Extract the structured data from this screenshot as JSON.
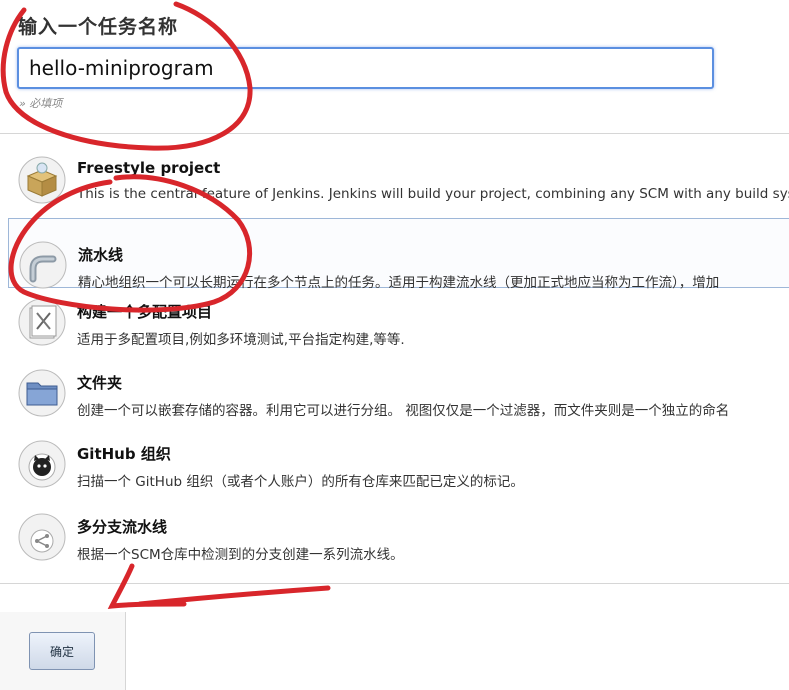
{
  "form": {
    "title": "输入一个任务名称",
    "name_value": "hello-miniprogram",
    "required_hint": "» 必填项"
  },
  "items": [
    {
      "title": "Freestyle project",
      "description": "This is the central feature of Jenkins. Jenkins will build your project, combining any SCM with any build system",
      "icon": "freestyle-box-icon"
    },
    {
      "title": "流水线",
      "description": "精心地组织一个可以长期运行在多个节点上的任务。适用于构建流水线（更加正式地应当称为工作流），增加",
      "icon": "pipeline-pipe-icon"
    },
    {
      "title": "构建一个多配置项目",
      "description": "适用于多配置项目,例如多环境测试,平台指定构建,等等.",
      "icon": "multi-config-tools-icon"
    },
    {
      "title": "文件夹",
      "description": "创建一个可以嵌套存储的容器。利用它可以进行分组。 视图仅仅是一个过滤器，而文件夹则是一个独立的命名",
      "icon": "folder-icon"
    },
    {
      "title": "GitHub 组织",
      "description": "扫描一个 GitHub 组织（或者个人账户）的所有仓库来匹配已定义的标记。",
      "icon": "github-octocat-icon"
    },
    {
      "title": "多分支流水线",
      "description": "根据一个SCM仓库中检测到的分支创建一系列流水线。",
      "icon": "branch-icon"
    }
  ],
  "footer": {
    "ok_label": "确定"
  },
  "colors": {
    "annotation": "#d8262b",
    "input_focus": "#5b8fe0"
  }
}
